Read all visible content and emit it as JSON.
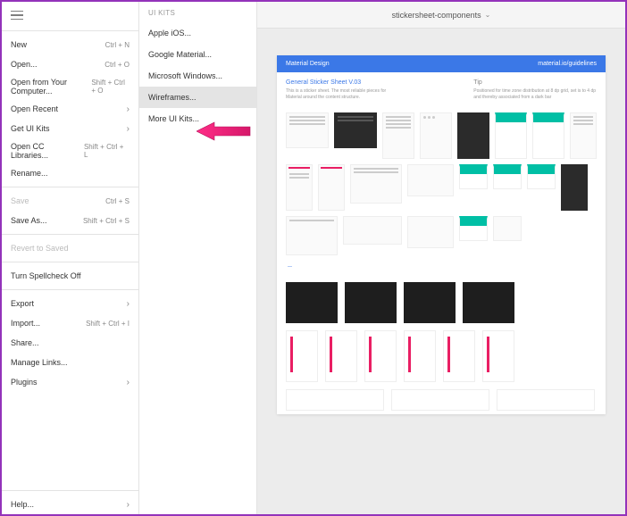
{
  "document": {
    "title": "stickersheet-components"
  },
  "menu": {
    "items": [
      {
        "label": "New",
        "shortcut": "Ctrl + N"
      },
      {
        "label": "Open...",
        "shortcut": "Ctrl + O"
      },
      {
        "label": "Open from Your Computer...",
        "shortcut": "Shift + Ctrl + O"
      },
      {
        "label": "Open Recent",
        "chevron": true
      },
      {
        "label": "Get UI Kits",
        "chevron": true
      },
      {
        "label": "Open CC Libraries...",
        "shortcut": "Shift + Ctrl + L"
      },
      {
        "label": "Rename..."
      }
    ],
    "group2": [
      {
        "label": "Save",
        "shortcut": "Ctrl + S",
        "disabled": true
      },
      {
        "label": "Save As...",
        "shortcut": "Shift + Ctrl + S"
      }
    ],
    "group3": [
      {
        "label": "Revert to Saved",
        "disabled": true
      }
    ],
    "group4": [
      {
        "label": "Turn Spellcheck Off"
      }
    ],
    "group5": [
      {
        "label": "Export",
        "chevron": true
      },
      {
        "label": "Import...",
        "shortcut": "Shift + Ctrl + I"
      },
      {
        "label": "Share..."
      },
      {
        "label": "Manage Links..."
      },
      {
        "label": "Plugins",
        "chevron": true
      }
    ],
    "footer": [
      {
        "label": "Help...",
        "chevron": true
      }
    ]
  },
  "submenu": {
    "header": "UI KITS",
    "items": [
      {
        "label": "Apple iOS..."
      },
      {
        "label": "Google Material..."
      },
      {
        "label": "Microsoft Windows..."
      },
      {
        "label": "Wireframes...",
        "selected": true
      },
      {
        "label": "More UI Kits..."
      }
    ]
  },
  "sheet": {
    "bar_left": "Material Design",
    "bar_right": "material.io/guidelines",
    "meta_title": "General Sticker Sheet V.03",
    "meta_sub": "This is a sticker sheet.\nThe most reliable pieces for Material around the content structure.",
    "tip_title": "Tip",
    "tip_sub": "Positioned for time zone distribution at 8 dp grid, set is to 4 dp and thereby associated from a dark bar"
  }
}
